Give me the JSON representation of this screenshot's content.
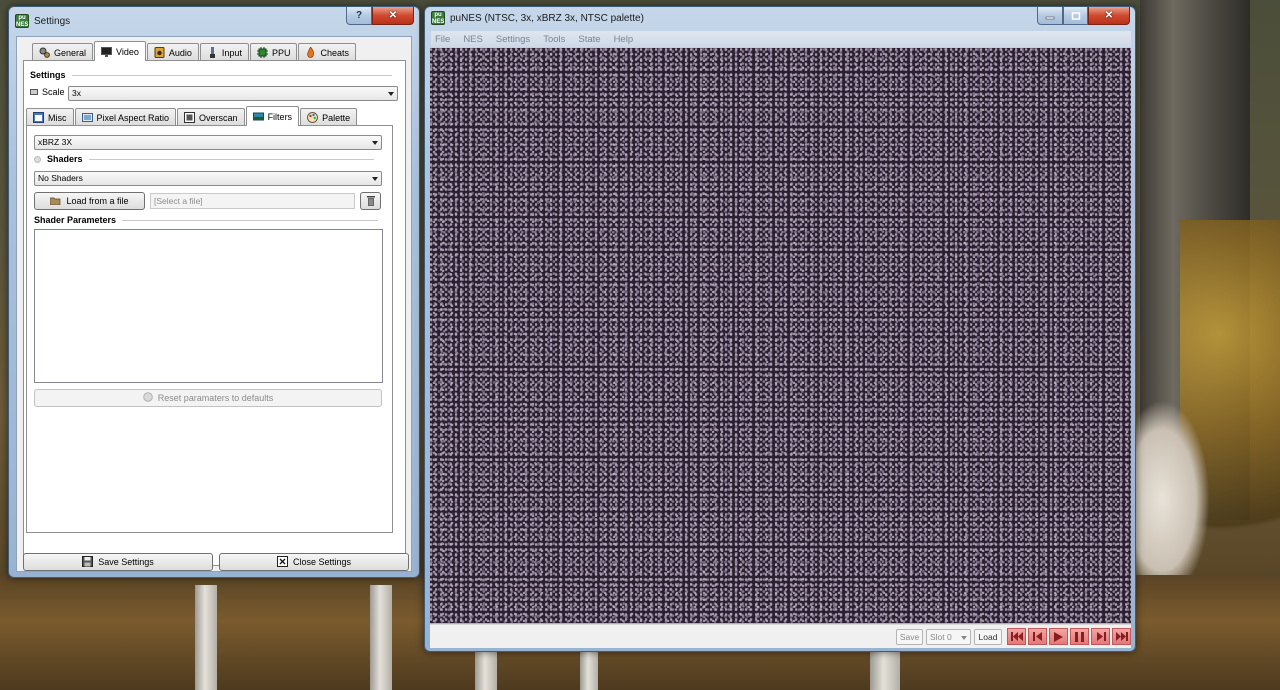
{
  "colors": {
    "accent": "#3c5a7c",
    "transport": "#e27979"
  },
  "settings_window": {
    "title": "Settings",
    "help_glyph": "?",
    "close_glyph": "✕",
    "top_tabs": [
      "General",
      "Video",
      "Audio",
      "Input",
      "PPU",
      "Cheats"
    ],
    "active_top_tab": "Video",
    "settings_group": "Settings",
    "scale_label": "Scale",
    "scale_value": "3x",
    "sub_tabs": [
      "Misc",
      "Pixel Aspect Ratio",
      "Overscan",
      "Filters",
      "Palette"
    ],
    "active_sub_tab": "Filters",
    "filter_value": "xBRZ 3X",
    "shaders_group": "Shaders",
    "shader_value": "No Shaders",
    "load_button": "Load from a file",
    "file_placeholder": "[Select a file]",
    "shader_params_group": "Shader Parameters",
    "reset_button": "Reset paramaters to defaults",
    "save_button": "Save Settings",
    "close_button": "Close Settings"
  },
  "punes_window": {
    "title": "puNES (NTSC, 3x, xBRZ 3x, NTSC palette)",
    "menu": [
      "File",
      "NES",
      "Settings",
      "Tools",
      "State",
      "Help"
    ],
    "status": {
      "save_label": "Save",
      "slot_value": "Slot 0",
      "load_label": "Load"
    },
    "transport_icons": [
      "rewind-start-icon",
      "step-back-icon",
      "play-icon",
      "pause-icon",
      "step-forward-icon",
      "fast-forward-icon"
    ]
  }
}
